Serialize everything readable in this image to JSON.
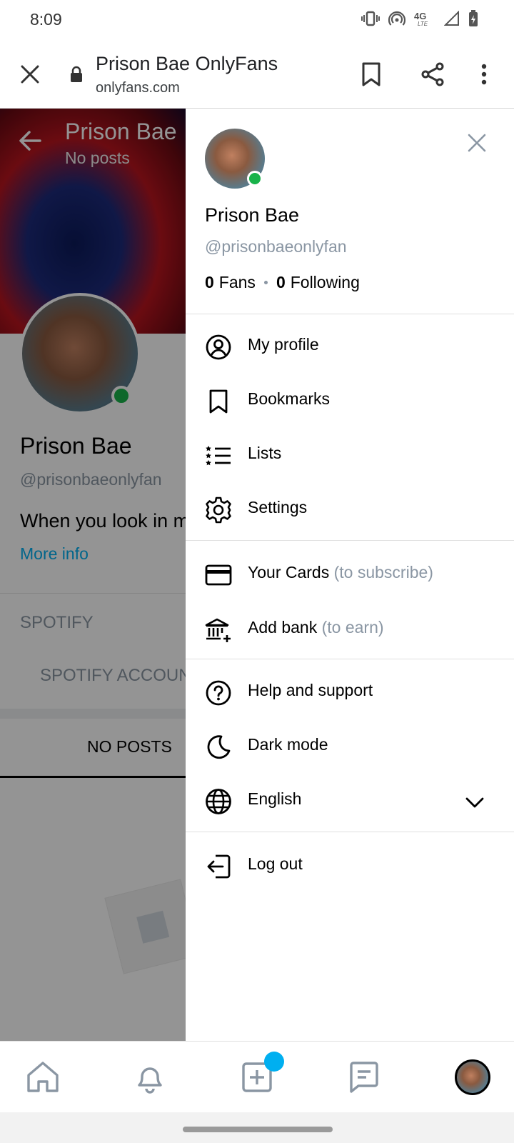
{
  "status_bar": {
    "time": "8:09"
  },
  "browser": {
    "title": "Prison Bae OnlyFans",
    "url": "onlyfans.com"
  },
  "profile_page": {
    "cover_name": "Prison Bae",
    "cover_subtitle": "No posts",
    "name": "Prison Bae",
    "handle": "@prisonbaeonlyfan",
    "bio": "When you look in m",
    "more_info": "More info",
    "section_title": "SPOTIFY",
    "section_item": "SPOTIFY ACCOUN",
    "tab_label": "NO POSTS"
  },
  "drawer": {
    "name": "Prison Bae",
    "handle": "@prisonbaeonlyfan",
    "fans_count": "0",
    "fans_label": "Fans",
    "following_count": "0",
    "following_label": "Following",
    "menu": {
      "my_profile": "My profile",
      "bookmarks": "Bookmarks",
      "lists": "Lists",
      "settings": "Settings",
      "your_cards": "Your Cards",
      "your_cards_hint": "(to subscribe)",
      "add_bank": "Add bank",
      "add_bank_hint": "(to earn)",
      "help": "Help and support",
      "dark_mode": "Dark mode",
      "language": "English",
      "log_out": "Log out"
    }
  },
  "colors": {
    "accent": "#00aff0",
    "online": "#19b34a",
    "muted_text": "#8a96a3"
  },
  "icons": [
    "close-icon",
    "lock-icon",
    "bookmark-icon",
    "share-icon",
    "more-vert-icon",
    "back-arrow-icon",
    "user-circle-icon",
    "list-icon",
    "gear-icon",
    "credit-card-icon",
    "bank-icon",
    "help-icon",
    "moon-icon",
    "globe-icon",
    "chevron-down-icon",
    "logout-icon",
    "home-icon",
    "bell-icon",
    "add-post-icon",
    "chat-icon"
  ]
}
